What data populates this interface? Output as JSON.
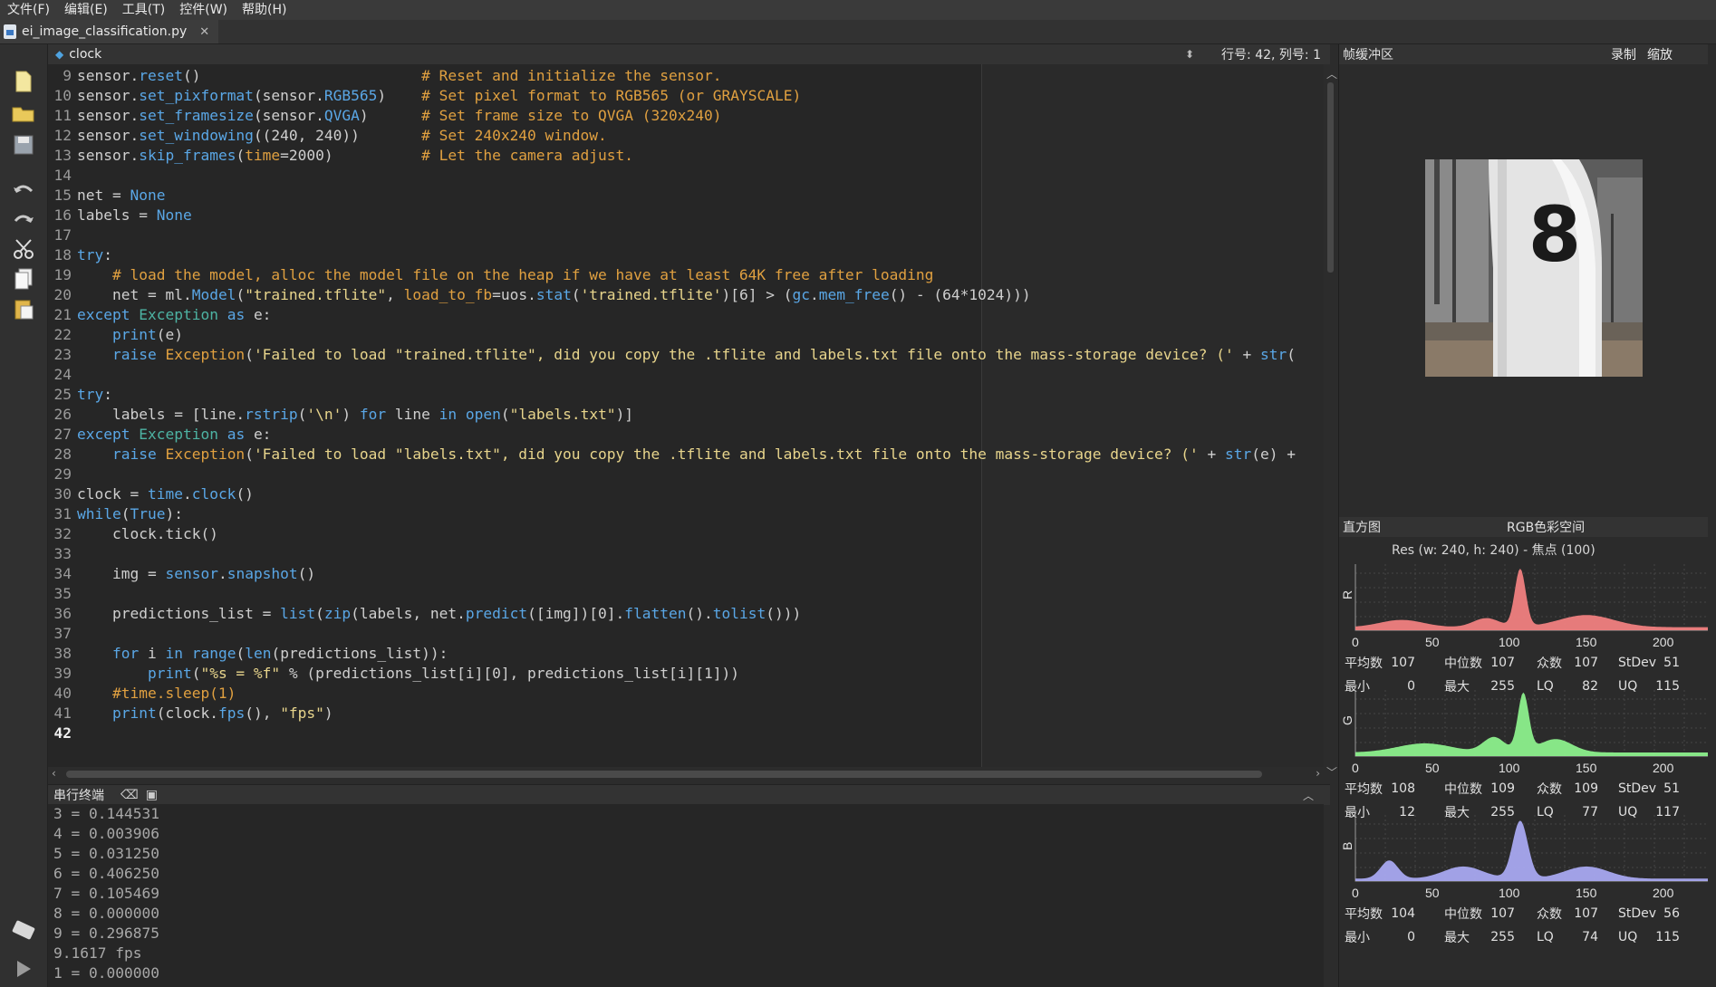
{
  "menu": [
    "文件(F)",
    "编辑(E)",
    "工具(T)",
    "控件(W)",
    "帮助(H)"
  ],
  "tab": {
    "filename": "ei_image_classification.py",
    "close": "✕"
  },
  "editor": {
    "function_label": "clock",
    "position": "行号: 42, 列号: 1",
    "lines": [
      {
        "n": "9",
        "segs": [
          [
            "sensor.",
            "#cfcfcf"
          ],
          [
            "reset",
            "#5aa7e6"
          ],
          [
            "()                         ",
            "#cfcfcf"
          ],
          [
            "# Reset and initialize the sensor.",
            "#e0a040"
          ]
        ]
      },
      {
        "n": "10",
        "segs": [
          [
            "sensor.",
            "#cfcfcf"
          ],
          [
            "set_pixformat",
            "#5aa7e6"
          ],
          [
            "(sensor.",
            "#cfcfcf"
          ],
          [
            "RGB565",
            "#5aa7e6"
          ],
          [
            ")    ",
            "#cfcfcf"
          ],
          [
            "# Set pixel format to RGB565 (or GRAYSCALE)",
            "#e0a040"
          ]
        ]
      },
      {
        "n": "11",
        "segs": [
          [
            "sensor.",
            "#cfcfcf"
          ],
          [
            "set_framesize",
            "#5aa7e6"
          ],
          [
            "(sensor.",
            "#cfcfcf"
          ],
          [
            "QVGA",
            "#5aa7e6"
          ],
          [
            ")      ",
            "#cfcfcf"
          ],
          [
            "# Set frame size to QVGA (320x240)",
            "#e0a040"
          ]
        ]
      },
      {
        "n": "12",
        "segs": [
          [
            "sensor.",
            "#cfcfcf"
          ],
          [
            "set_windowing",
            "#5aa7e6"
          ],
          [
            "((240, 240))       ",
            "#cfcfcf"
          ],
          [
            "# Set 240x240 window.",
            "#e0a040"
          ]
        ]
      },
      {
        "n": "13",
        "segs": [
          [
            "sensor.",
            "#cfcfcf"
          ],
          [
            "skip_frames",
            "#5aa7e6"
          ],
          [
            "(",
            "#cfcfcf"
          ],
          [
            "time",
            "#e0a040"
          ],
          [
            "=2000)          ",
            "#cfcfcf"
          ],
          [
            "# Let the camera adjust.",
            "#e0a040"
          ]
        ]
      },
      {
        "n": "14",
        "segs": []
      },
      {
        "n": "15",
        "segs": [
          [
            "net = ",
            "#cfcfcf"
          ],
          [
            "None",
            "#5aa7e6"
          ]
        ]
      },
      {
        "n": "16",
        "segs": [
          [
            "labels = ",
            "#cfcfcf"
          ],
          [
            "None",
            "#5aa7e6"
          ]
        ]
      },
      {
        "n": "17",
        "segs": []
      },
      {
        "n": "18",
        "segs": [
          [
            "try",
            "#5aa7e6"
          ],
          [
            ":",
            "#cfcfcf"
          ]
        ]
      },
      {
        "n": "19",
        "segs": [
          [
            "    ",
            "#cfcfcf"
          ],
          [
            "# load the model, alloc the model file on the heap if we have at least 64K free after loading",
            "#e0a040"
          ]
        ]
      },
      {
        "n": "20",
        "segs": [
          [
            "    net = ml.",
            "#cfcfcf"
          ],
          [
            "Model",
            "#5aa7e6"
          ],
          [
            "(",
            "#cfcfcf"
          ],
          [
            "\"trained.tflite\"",
            "#e8d58c"
          ],
          [
            ", ",
            "#cfcfcf"
          ],
          [
            "load_to_fb",
            "#e0a040"
          ],
          [
            "=uos.",
            "#cfcfcf"
          ],
          [
            "stat",
            "#5aa7e6"
          ],
          [
            "(",
            "#cfcfcf"
          ],
          [
            "'trained.tflite'",
            "#e8d58c"
          ],
          [
            ")[6] > (",
            "#cfcfcf"
          ],
          [
            "gc",
            "#5aa7e6"
          ],
          [
            ".",
            "#cfcfcf"
          ],
          [
            "mem_free",
            "#5aa7e6"
          ],
          [
            "() - (64*1024)))",
            "#cfcfcf"
          ]
        ]
      },
      {
        "n": "21",
        "segs": [
          [
            "except ",
            "#5aa7e6"
          ],
          [
            "Exception",
            "#4db3a3"
          ],
          [
            " as ",
            "#5aa7e6"
          ],
          [
            "e:",
            "#cfcfcf"
          ]
        ]
      },
      {
        "n": "22",
        "segs": [
          [
            "    ",
            "#cfcfcf"
          ],
          [
            "print",
            "#5aa7e6"
          ],
          [
            "(e)",
            "#cfcfcf"
          ]
        ]
      },
      {
        "n": "23",
        "segs": [
          [
            "    ",
            "#cfcfcf"
          ],
          [
            "raise ",
            "#5aa7e6"
          ],
          [
            "Exception",
            "#e0a040"
          ],
          [
            "(",
            "#cfcfcf"
          ],
          [
            "'Failed to load \"trained.tflite\", did you copy the .tflite and labels.txt file onto the mass-storage device? ('",
            "#e8d58c"
          ],
          [
            " + ",
            "#cfcfcf"
          ],
          [
            "str",
            "#5aa7e6"
          ],
          [
            "(",
            "#cfcfcf"
          ]
        ]
      },
      {
        "n": "24",
        "segs": []
      },
      {
        "n": "25",
        "segs": [
          [
            "try",
            "#5aa7e6"
          ],
          [
            ":",
            "#cfcfcf"
          ]
        ]
      },
      {
        "n": "26",
        "segs": [
          [
            "    labels = [line.",
            "#cfcfcf"
          ],
          [
            "rstrip",
            "#5aa7e6"
          ],
          [
            "(",
            "#cfcfcf"
          ],
          [
            "'\\n'",
            "#e8d58c"
          ],
          [
            ") ",
            "#cfcfcf"
          ],
          [
            "for",
            "#5aa7e6"
          ],
          [
            " line ",
            "#cfcfcf"
          ],
          [
            "in",
            "#5aa7e6"
          ],
          [
            " ",
            "#cfcfcf"
          ],
          [
            "open",
            "#5aa7e6"
          ],
          [
            "(",
            "#cfcfcf"
          ],
          [
            "\"labels.txt\"",
            "#e8d58c"
          ],
          [
            ")]",
            "#cfcfcf"
          ]
        ]
      },
      {
        "n": "27",
        "segs": [
          [
            "except ",
            "#5aa7e6"
          ],
          [
            "Exception",
            "#4db3a3"
          ],
          [
            " as ",
            "#5aa7e6"
          ],
          [
            "e:",
            "#cfcfcf"
          ]
        ]
      },
      {
        "n": "28",
        "segs": [
          [
            "    ",
            "#cfcfcf"
          ],
          [
            "raise ",
            "#5aa7e6"
          ],
          [
            "Exception",
            "#e0a040"
          ],
          [
            "(",
            "#cfcfcf"
          ],
          [
            "'Failed to load \"labels.txt\", did you copy the .tflite and labels.txt file onto the mass-storage device? ('",
            "#e8d58c"
          ],
          [
            " + ",
            "#cfcfcf"
          ],
          [
            "str",
            "#5aa7e6"
          ],
          [
            "(e) +",
            "#cfcfcf"
          ]
        ]
      },
      {
        "n": "29",
        "segs": []
      },
      {
        "n": "30",
        "segs": [
          [
            "clock = ",
            "#cfcfcf"
          ],
          [
            "time",
            "#5aa7e6"
          ],
          [
            ".",
            "#cfcfcf"
          ],
          [
            "clock",
            "#5aa7e6"
          ],
          [
            "()",
            "#cfcfcf"
          ]
        ]
      },
      {
        "n": "31",
        "segs": [
          [
            "while",
            "#5aa7e6"
          ],
          [
            "(",
            "#cfcfcf"
          ],
          [
            "True",
            "#5aa7e6"
          ],
          [
            "):",
            "#cfcfcf"
          ]
        ]
      },
      {
        "n": "32",
        "segs": [
          [
            "    clock.tick()",
            "#cfcfcf"
          ]
        ]
      },
      {
        "n": "33",
        "segs": []
      },
      {
        "n": "34",
        "segs": [
          [
            "    img = ",
            "#cfcfcf"
          ],
          [
            "sensor",
            "#5aa7e6"
          ],
          [
            ".",
            "#cfcfcf"
          ],
          [
            "snapshot",
            "#5aa7e6"
          ],
          [
            "()",
            "#cfcfcf"
          ]
        ]
      },
      {
        "n": "35",
        "segs": []
      },
      {
        "n": "36",
        "segs": [
          [
            "    predictions_list = ",
            "#cfcfcf"
          ],
          [
            "list",
            "#5aa7e6"
          ],
          [
            "(",
            "#cfcfcf"
          ],
          [
            "zip",
            "#5aa7e6"
          ],
          [
            "(labels, net.",
            "#cfcfcf"
          ],
          [
            "predict",
            "#5aa7e6"
          ],
          [
            "([img])[0].",
            "#cfcfcf"
          ],
          [
            "flatten",
            "#5aa7e6"
          ],
          [
            "().",
            "#cfcfcf"
          ],
          [
            "tolist",
            "#5aa7e6"
          ],
          [
            "()))",
            "#cfcfcf"
          ]
        ]
      },
      {
        "n": "37",
        "segs": []
      },
      {
        "n": "38",
        "segs": [
          [
            "    ",
            "#cfcfcf"
          ],
          [
            "for",
            "#5aa7e6"
          ],
          [
            " i ",
            "#cfcfcf"
          ],
          [
            "in",
            "#5aa7e6"
          ],
          [
            " ",
            "#cfcfcf"
          ],
          [
            "range",
            "#5aa7e6"
          ],
          [
            "(",
            "#cfcfcf"
          ],
          [
            "len",
            "#5aa7e6"
          ],
          [
            "(predictions_list)):",
            "#cfcfcf"
          ]
        ]
      },
      {
        "n": "39",
        "segs": [
          [
            "        ",
            "#cfcfcf"
          ],
          [
            "print",
            "#5aa7e6"
          ],
          [
            "(",
            "#cfcfcf"
          ],
          [
            "\"%s = %f\"",
            "#e8d58c"
          ],
          [
            " % (predictions_list[i][0], predictions_list[i][1]))",
            "#cfcfcf"
          ]
        ]
      },
      {
        "n": "40",
        "segs": [
          [
            "    ",
            "#cfcfcf"
          ],
          [
            "#time.sleep(1)",
            "#e0a040"
          ]
        ]
      },
      {
        "n": "41",
        "segs": [
          [
            "    ",
            "#cfcfcf"
          ],
          [
            "print",
            "#5aa7e6"
          ],
          [
            "(clock.",
            "#cfcfcf"
          ],
          [
            "fps",
            "#5aa7e6"
          ],
          [
            "(), ",
            "#cfcfcf"
          ],
          [
            "\"fps\"",
            "#e8d58c"
          ],
          [
            ")",
            "#cfcfcf"
          ]
        ]
      },
      {
        "n": "42",
        "segs": [],
        "current": true
      }
    ]
  },
  "terminal": {
    "title": "串行终端",
    "lines": [
      "3 = 0.144531",
      "4 = 0.003906",
      "5 = 0.031250",
      "6 = 0.406250",
      "7 = 0.105469",
      "8 = 0.000000",
      "9 = 0.296875",
      "9.1617 fps",
      "1 = 0.000000"
    ]
  },
  "framebuffer": {
    "title": "帧缓冲区",
    "record": "录制",
    "zoom": "缩放",
    "digit": "8"
  },
  "histogram": {
    "title": "直方图",
    "colorspace": "RGB色彩空间",
    "res": "Res  (w: 240, h: 240) - 焦点  (100)",
    "ticks": [
      "0",
      "50",
      "100",
      "150",
      "200"
    ],
    "labels": {
      "mean": "平均数",
      "median": "中位数",
      "mode": "众数",
      "stdev": "StDev",
      "min": "最小",
      "max": "最大",
      "lq": "LQ",
      "uq": "UQ"
    },
    "channels": [
      {
        "name": "R",
        "fill": "#f08080",
        "stats": {
          "mean": "107",
          "median": "107",
          "mode": "107",
          "stdev": "51",
          "min": "0",
          "max": "255",
          "lq": "82",
          "uq": "115"
        }
      },
      {
        "name": "G",
        "fill": "#8cf08c",
        "stats": {
          "mean": "108",
          "median": "109",
          "mode": "109",
          "stdev": "51",
          "min": "12",
          "max": "255",
          "lq": "77",
          "uq": "117"
        }
      },
      {
        "name": "B",
        "fill": "#a8a8f0",
        "stats": {
          "mean": "104",
          "median": "107",
          "mode": "107",
          "stdev": "56",
          "min": "0",
          "max": "255",
          "lq": "74",
          "uq": "115"
        }
      }
    ]
  }
}
